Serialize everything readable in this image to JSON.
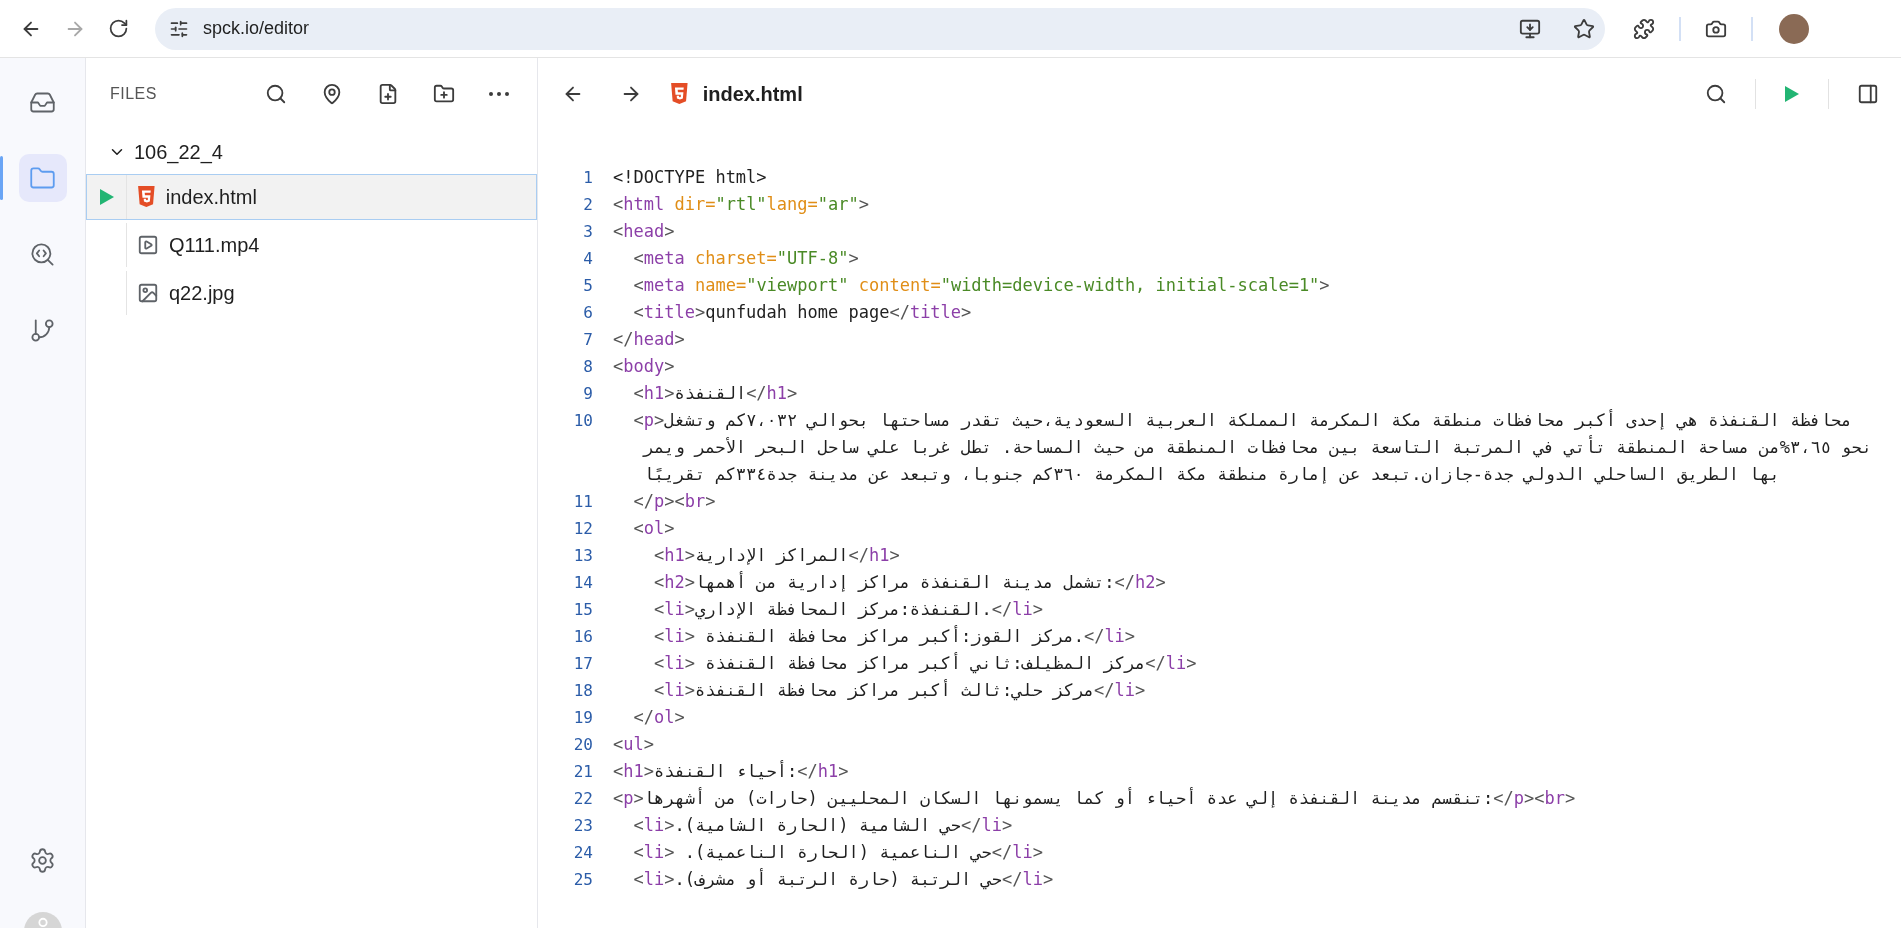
{
  "browser": {
    "url": "spck.io/editor",
    "forward_disabled": true
  },
  "rail": {
    "items": [
      {
        "kind": "inbox",
        "selected": false
      },
      {
        "kind": "files",
        "selected": true
      },
      {
        "kind": "code-search",
        "selected": false
      },
      {
        "kind": "git",
        "selected": false
      }
    ],
    "bottom": [
      {
        "kind": "settings"
      },
      {
        "kind": "account"
      }
    ]
  },
  "files": {
    "title": "FILES",
    "tree": {
      "name": "106_22_4",
      "expanded": true,
      "children": [
        {
          "name": "index.html",
          "kind": "html",
          "selected": true,
          "running": true
        },
        {
          "name": "Q111.mp4",
          "kind": "video",
          "selected": false,
          "running": false
        },
        {
          "name": "q22.jpg",
          "kind": "image",
          "selected": false,
          "running": false
        }
      ]
    }
  },
  "editor": {
    "file": {
      "name": "index.html",
      "kind": "html"
    },
    "lines": [
      {
        "number": "1",
        "code": "<!DOCTYPE html>"
      },
      {
        "number": "2",
        "code": "<html dir=\"rtl\"lang=\"ar\">"
      },
      {
        "number": "3",
        "code": "<head>"
      },
      {
        "number": "4",
        "code": "  <meta charset=\"UTF-8\">"
      },
      {
        "number": "5",
        "code": "  <meta name=\"viewport\" content=\"width=device-width, initial-scale=1\">"
      },
      {
        "number": "6",
        "code": "  <title>qunfudah home page</title>"
      },
      {
        "number": "7",
        "code": "</head>"
      },
      {
        "number": "8",
        "code": "<body>"
      },
      {
        "number": "9",
        "code": "  <h1>القنفذة</h1>"
      },
      {
        "number": "10",
        "code": "  <p>محافظة القنفذة هي إحدى أكبر محافظات منطقة مكة المكرمة المملكة العربية السعودية،حيث تقدر مساحتها بحوالي ٧،٠٣٢كم وتشغل نحو ٣،٦٥%من مساحة المنطقة تأتي في المرتبة التاسعة بين محافظات المنطقة من حيث المساحة. تطل غربا علي ساحل البحر الأحمر ويمر بها الطريق الساحلي الدولي جدة-جازان.تبعد عن إمارة منطقة مكة المكرمة ٣٦٠كم جنوبا، وتبعد عن مدينة جدة٣٣٤كم تقريبًا"
      },
      {
        "number": "11",
        "code": "  </p><br>"
      },
      {
        "number": "12",
        "code": "  <ol>"
      },
      {
        "number": "13",
        "code": "    <h1>المراكز الإدارية</h1>"
      },
      {
        "number": "14",
        "code": "    <h2>:تشمل مدينة القنفذة مراكز إدارية من أهمها</h2>"
      },
      {
        "number": "15",
        "code": "    <li>.القنفذة:مركز المحافظة الإداري</li>"
      },
      {
        "number": "16",
        "code": "    <li> .مركز القوز:أكبر مراكز محافظة القنفذة</li>"
      },
      {
        "number": "17",
        "code": "    <li> مركز المظيلف:ثاني أكبر مراكز محافظة القنفذة</li>"
      },
      {
        "number": "18",
        "code": "    <li>مركز حلي:ثالث أكبر مراكز محافظة القنفذة</li>"
      },
      {
        "number": "19",
        "code": "  </ol>"
      },
      {
        "number": "20",
        "code": "<ul>"
      },
      {
        "number": "21",
        "code": "<h1>:أحياء القنفذة</h1>"
      },
      {
        "number": "22",
        "code": "<p>:تنقسم مدينة القنفذة إلي عدة أحياء أو كما يسمونها السكان المحليين (حارات) من أشهرها</p><br>"
      },
      {
        "number": "23",
        "code": "  <li>حي الشامية (الحارة الشامية).</li>"
      },
      {
        "number": "24",
        "code": "  <li> حي الناعمية (الحارة الناعمية).</li>"
      },
      {
        "number": "25",
        "code": "  <li>حي الرتبة (حارة الرتبة أو مشرف).</li>"
      }
    ]
  }
}
